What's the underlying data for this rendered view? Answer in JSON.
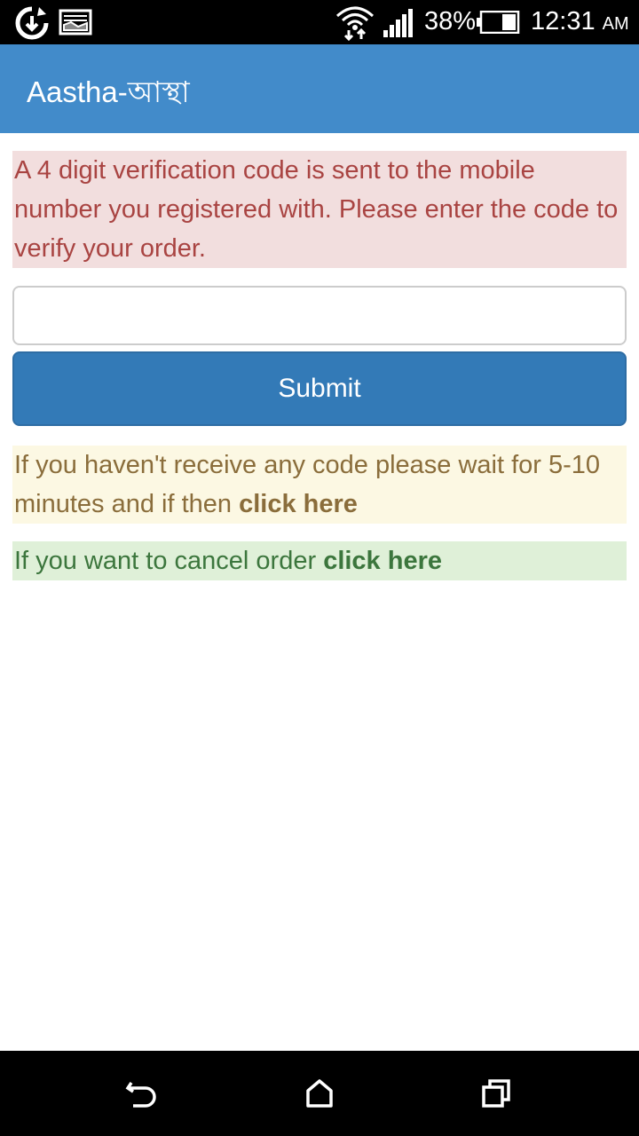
{
  "status_bar": {
    "battery_percent": "38%",
    "time": "12:31",
    "ampm": "AM",
    "icons": [
      "sync-icon",
      "image-icon",
      "wifi-icon",
      "signal-icon",
      "battery-icon"
    ]
  },
  "app_bar": {
    "title": "Aastha-আস্থা",
    "color": "#428bca"
  },
  "verification": {
    "message": "A 4 digit verification code is sent to the mobile number you registered with. Please enter the code to verify your order.",
    "code_value": "",
    "code_placeholder": "",
    "submit_label": "Submit"
  },
  "resend": {
    "text": "If you haven't receive any code please wait for 5-10 minutes and if then ",
    "link_label": "click here"
  },
  "cancel": {
    "text": "If you want to cancel order ",
    "link_label": "click here"
  },
  "nav_bar": {
    "icons": [
      "back-icon",
      "home-icon",
      "recents-icon"
    ]
  }
}
